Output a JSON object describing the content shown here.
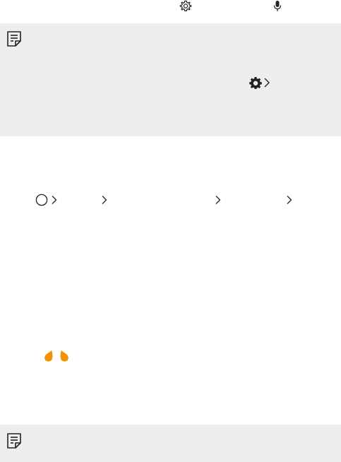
{
  "top_line": {
    "icons": [
      "gear-outline-icon",
      "microphone-icon"
    ]
  },
  "note_box_1": {
    "icons": [
      "note-icon",
      "gear-filled-icon",
      "chevron-right-icon"
    ]
  },
  "breadcrumb": {
    "icons": [
      "home-circle-icon",
      "chevron-right-icon",
      "chevron-right-icon",
      "chevron-right-icon",
      "chevron-right-icon"
    ]
  },
  "earbuds": {
    "icon": "earbuds-icon",
    "color": "#f39200"
  },
  "note_box_2": {
    "icons": [
      "note-icon"
    ]
  },
  "colors": {
    "note_background": "#eeeeee",
    "icon_stroke": "#222222",
    "accent": "#f39200"
  }
}
